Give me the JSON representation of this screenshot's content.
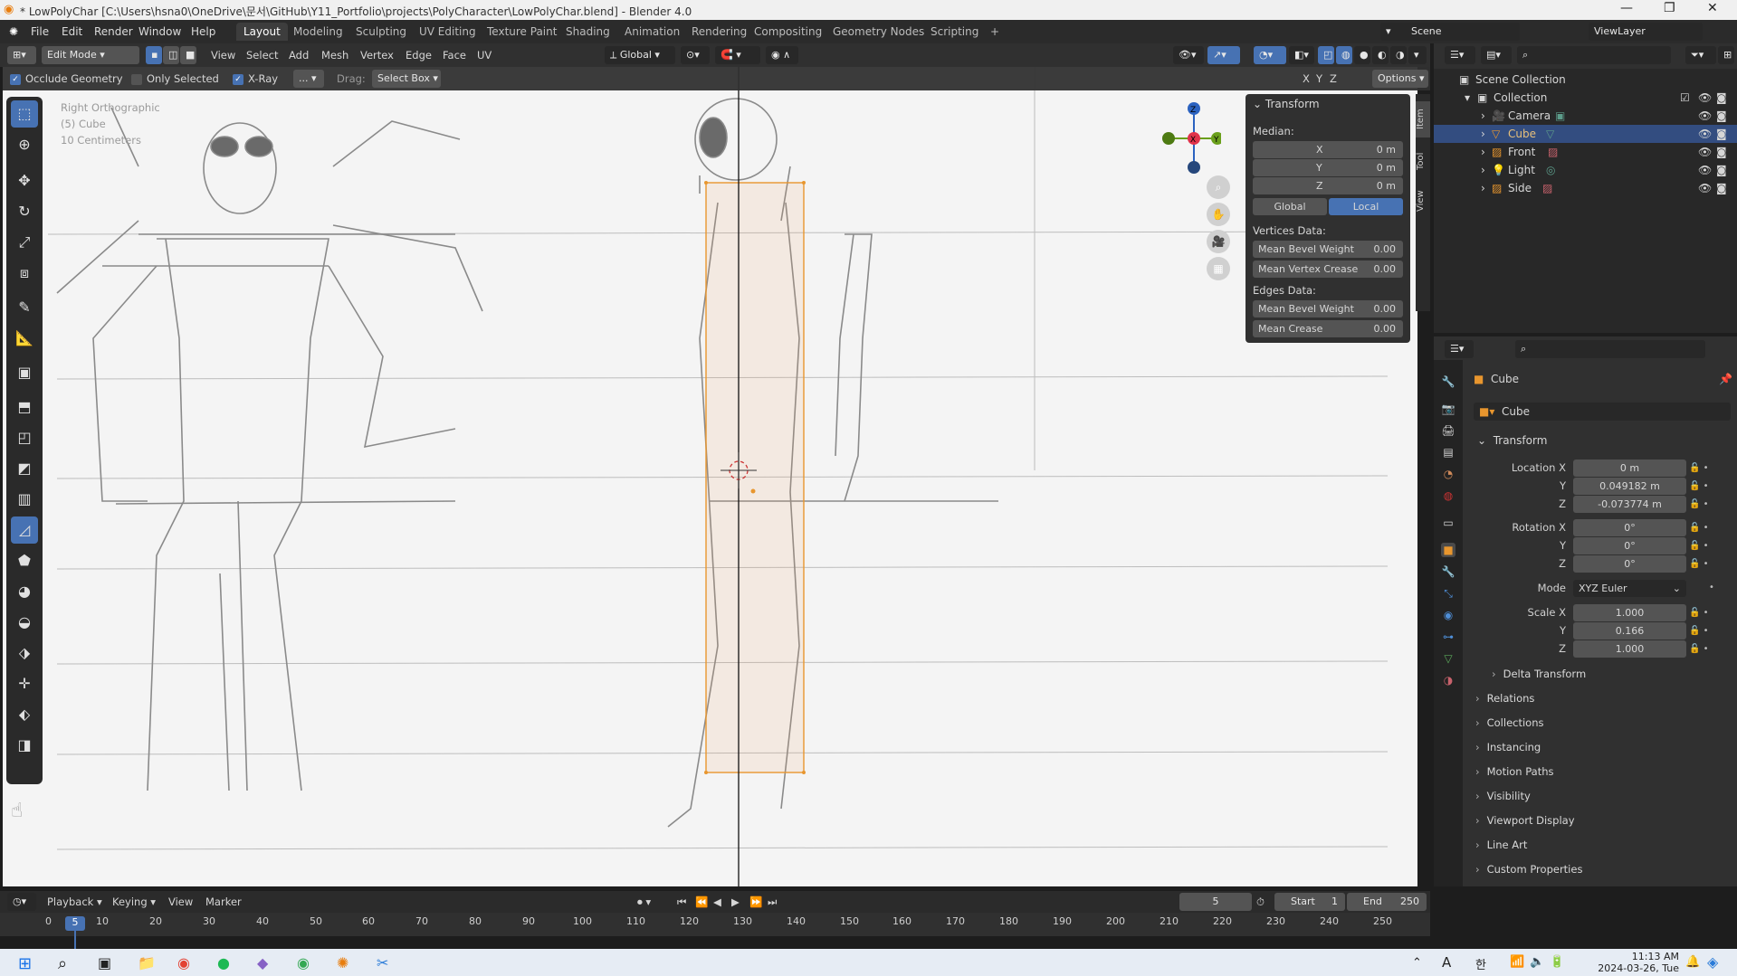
{
  "window": {
    "title": "* LowPolyChar [C:\\Users\\hsna0\\OneDrive\\문서\\GitHub\\Y11_Portfolio\\projects\\PolyCharacter\\LowPolyChar.blend] - Blender 4.0",
    "minimize": "—",
    "maximize": "❐",
    "close": "✕"
  },
  "menubar": {
    "items": [
      "File",
      "Edit",
      "Render",
      "Window",
      "Help"
    ],
    "workspaces": [
      "Layout",
      "Modeling",
      "Sculpting",
      "UV Editing",
      "Texture Paint",
      "Shading",
      "Animation",
      "Rendering",
      "Compositing",
      "Geometry Nodes",
      "Scripting",
      "+"
    ],
    "active_workspace": "Layout",
    "scene": "Scene",
    "view_layer": "ViewLayer"
  },
  "header": {
    "mode": "Edit Mode",
    "menus": [
      "View",
      "Select",
      "Add",
      "Mesh",
      "Vertex",
      "Edge",
      "Face",
      "UV"
    ],
    "orientation": "Global",
    "options": "Options"
  },
  "tool_header": {
    "occlude_geometry": "Occlude Geometry",
    "only_selected": "Only Selected",
    "xray": "X-Ray",
    "more": "...",
    "drag_label": "Drag:",
    "drag_value": "Select Box",
    "axes": [
      "X",
      "Y",
      "Z"
    ]
  },
  "viewport": {
    "view_name": "Right Orthographic",
    "object_info": "(5) Cube",
    "scale": "10 Centimeters",
    "gizmo": {
      "z": "Z",
      "x": "X",
      "y": "Y"
    }
  },
  "npanel": {
    "section": "Transform",
    "median_label": "Median:",
    "fields": [
      {
        "label": "X",
        "value": "0 m"
      },
      {
        "label": "Y",
        "value": "0 m"
      },
      {
        "label": "Z",
        "value": "0 m"
      }
    ],
    "global": "Global",
    "local": "Local",
    "vertices_data": "Vertices Data:",
    "mean_bevel_weight": "Mean Bevel Weight",
    "mean_bevel_weight_v": "0.00",
    "mean_vertex_crease": "Mean Vertex Crease",
    "mean_vertex_crease_v": "0.00",
    "edges_data": "Edges Data:",
    "edge_bevel_weight": "Mean Bevel Weight",
    "edge_bevel_weight_v": "0.00",
    "mean_crease": "Mean Crease",
    "mean_crease_v": "0.00",
    "tabs": [
      "Item",
      "Tool",
      "View"
    ]
  },
  "outliner": {
    "root": "Scene Collection",
    "collection": "Collection",
    "items": [
      "Camera",
      "Cube",
      "Front",
      "Light",
      "Side"
    ],
    "selected": "Cube"
  },
  "properties": {
    "object_name": "Cube",
    "data_name": "Cube",
    "transform": "Transform",
    "location_x_label": "Location X",
    "location_x": "0 m",
    "location_y": "0.049182 m",
    "location_z": "-0.073774 m",
    "rotation_x_label": "Rotation X",
    "rotation_x": "0°",
    "rotation_y": "0°",
    "rotation_z": "0°",
    "mode_label": "Mode",
    "mode_value": "XYZ Euler",
    "scale_x_label": "Scale X",
    "scale_x": "1.000",
    "scale_y": "0.166",
    "scale_z": "1.000",
    "y": "Y",
    "z": "Z",
    "sections": [
      "Delta Transform",
      "Relations",
      "Collections",
      "Instancing",
      "Motion Paths",
      "Visibility",
      "Viewport Display",
      "Line Art",
      "Custom Properties"
    ]
  },
  "timeline": {
    "menus": [
      "Playback",
      "Keying",
      "View",
      "Marker"
    ],
    "current_frame": "5",
    "start_label": "Start",
    "start": "1",
    "end_label": "End",
    "end": "250",
    "ticks": [
      "0",
      "10",
      "20",
      "30",
      "40",
      "50",
      "60",
      "70",
      "80",
      "90",
      "100",
      "110",
      "120",
      "130",
      "140",
      "150",
      "160",
      "170",
      "180",
      "190",
      "200",
      "210",
      "220",
      "230",
      "240",
      "250"
    ]
  },
  "taskbar": {
    "time": "11:13 AM",
    "date": "2024-03-26, Tue",
    "lang": "A",
    "ime": "한"
  },
  "colors": {
    "accent": "#4772b3",
    "selection": "#e8962e"
  }
}
